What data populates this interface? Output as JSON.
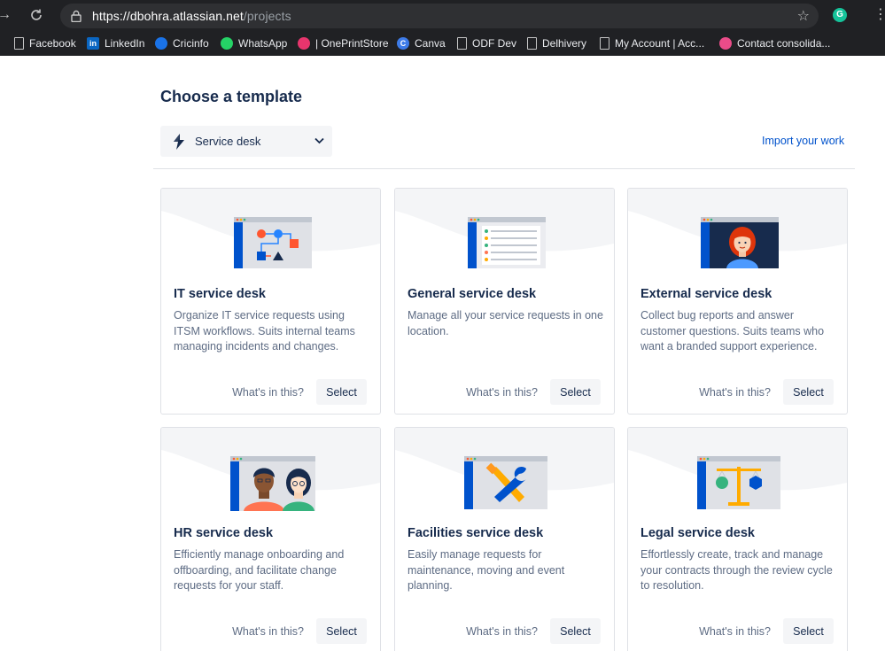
{
  "browser": {
    "url_host": "https://dbohra.atlassian.net",
    "url_path": "/projects",
    "extension_letter": "G",
    "bookmarks": [
      {
        "label": "Facebook",
        "icon": "document-icon"
      },
      {
        "label": "LinkedIn",
        "icon": "linkedin-icon",
        "icon_text": "in",
        "color": "#0a66c2"
      },
      {
        "label": "Cricinfo",
        "icon": "cricinfo-icon",
        "color": "#1a73e8"
      },
      {
        "label": "WhatsApp",
        "icon": "whatsapp-icon",
        "color": "#25d366"
      },
      {
        "label": "| OnePrintStore",
        "icon": "oneprintstore-icon",
        "color": "#e8356d"
      },
      {
        "label": "Canva",
        "icon": "canva-icon",
        "icon_text": "C",
        "color": "#3d7be8"
      },
      {
        "label": "ODF Dev",
        "icon": "document-icon"
      },
      {
        "label": "Delhivery",
        "icon": "document-icon"
      },
      {
        "label": "My Account | Acc...",
        "icon": "document-icon"
      },
      {
        "label": "Contact consolida...",
        "icon": "dribbble-icon",
        "color": "#ea4c89"
      }
    ]
  },
  "page": {
    "title": "Choose a template",
    "dropdown_value": "Service desk",
    "import_link": "Import your work"
  },
  "cards": [
    {
      "title": "IT service desk",
      "description": "Organize IT service requests using ITSM workflows. Suits internal teams managing incidents and changes.",
      "whats_label": "What's in this?",
      "select_label": "Select",
      "illustration": "workflow-illustration-icon"
    },
    {
      "title": "General service desk",
      "description": "Manage all your service requests in one location.",
      "whats_label": "What's in this?",
      "select_label": "Select",
      "illustration": "checklist-illustration-icon"
    },
    {
      "title": "External service desk",
      "description": "Collect bug reports and answer customer questions. Suits teams who want a branded support experience.",
      "whats_label": "What's in this?",
      "select_label": "Select",
      "illustration": "customer-illustration-icon"
    },
    {
      "title": "HR service desk",
      "description": "Efficiently manage onboarding and offboarding, and facilitate change requests for your staff.",
      "whats_label": "What's in this?",
      "select_label": "Select",
      "illustration": "people-illustration-icon"
    },
    {
      "title": "Facilities service desk",
      "description": "Easily manage requests for maintenance, moving and event planning.",
      "whats_label": "What's in this?",
      "select_label": "Select",
      "illustration": "tools-illustration-icon"
    },
    {
      "title": "Legal service desk",
      "description": "Effortlessly create, track and manage your contracts through the review cycle to resolution.",
      "whats_label": "What's in this?",
      "select_label": "Select",
      "illustration": "scales-illustration-icon"
    }
  ],
  "colors": {
    "link": "#0052cc",
    "heading": "#172b4d",
    "muted": "#5e6c84",
    "button_bg": "#f4f5f7",
    "border": "#dfe1e6"
  }
}
